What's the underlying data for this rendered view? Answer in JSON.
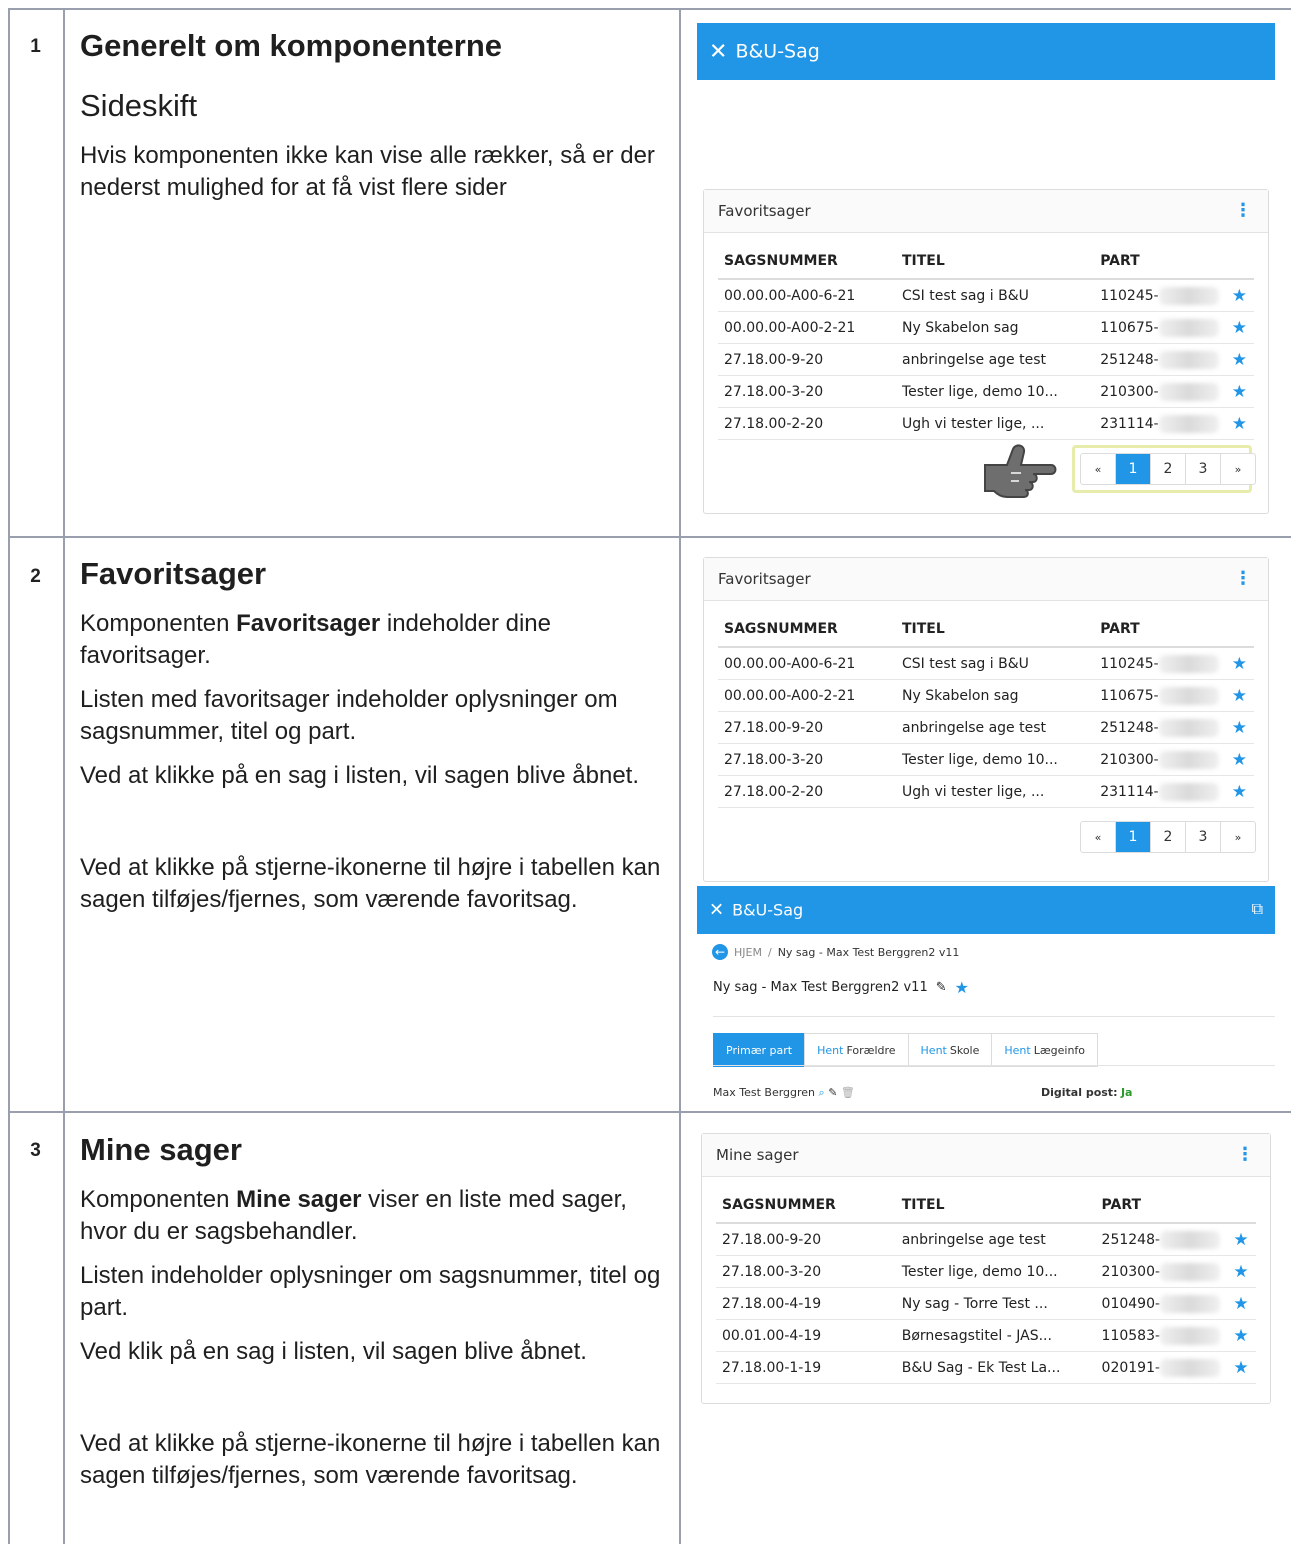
{
  "rows": [
    {
      "number": "1",
      "heading": "Generelt om komponenterne",
      "subheading": "Sideskift",
      "text": "Hvis komponenten ikke kan vise alle rækker, så er der nederst mulighed for at få vist flere sider"
    },
    {
      "number": "2",
      "heading": "Favoritsager",
      "p1_prefix": "Komponenten ",
      "p1_bold": "Favoritsager",
      "p1_suffix": " indeholder dine favoritsager.",
      "p2": "Listen med favoritsager indeholder oplysninger om sagsnummer, titel og part.",
      "p3": "Ved at klikke på en sag i listen, vil sagen blive åbnet.",
      "p4": "Ved at klikke på stjerne-ikonerne til højre i tabellen kan sagen tilføjes/fjernes, som værende favoritsag."
    },
    {
      "number": "3",
      "heading": "Mine sager",
      "p1_prefix": "Komponenten ",
      "p1_bold": "Mine sager",
      "p1_suffix": " viser en liste med sager, hvor du er sagsbehandler.",
      "p2": "Listen indeholder oplysninger om sagsnummer, titel og part.",
      "p3": "Ved klik på en sag i listen, vil sagen blive åbnet.",
      "p4": "Ved at klikke på stjerne-ikonerne til højre i tabellen kan sagen tilføjes/fjernes, som værende favoritsag."
    }
  ],
  "app": {
    "brand": "B&U-Sag",
    "brand_color": "#2196e6"
  },
  "favorites": {
    "title": "Favoritsager",
    "columns": [
      "SAGSNUMMER",
      "TITEL",
      "PART"
    ],
    "rows": [
      {
        "nr": "00.00.00-A00-6-21",
        "title": "CSI test sag i B&U",
        "part": "110245-"
      },
      {
        "nr": "00.00.00-A00-2-21",
        "title": "Ny Skabelon sag",
        "part": "110675-"
      },
      {
        "nr": "27.18.00-9-20",
        "title": "anbringelse age test",
        "part": "251248-"
      },
      {
        "nr": "27.18.00-3-20",
        "title": "Tester lige, demo 10...",
        "part": "210300-"
      },
      {
        "nr": "27.18.00-2-20",
        "title": "Ugh vi tester lige, ...",
        "part": "231114-"
      }
    ],
    "pager": [
      "«",
      "1",
      "2",
      "3",
      "»"
    ]
  },
  "mine": {
    "title": "Mine sager",
    "columns": [
      "SAGSNUMMER",
      "TITEL",
      "PART"
    ],
    "rows": [
      {
        "nr": "27.18.00-9-20",
        "title": "anbringelse age test",
        "part": "251248-"
      },
      {
        "nr": "27.18.00-3-20",
        "title": "Tester lige, demo 10...",
        "part": "210300-"
      },
      {
        "nr": "27.18.00-4-19",
        "title": "Ny sag - Torre Test ...",
        "part": "010490-"
      },
      {
        "nr": "00.01.00-4-19",
        "title": "Børnesagstitel - JAS...",
        "part": "110583-"
      },
      {
        "nr": "27.18.00-1-19",
        "title": "B&U Sag - Ek Test La...",
        "part": "020191-"
      }
    ]
  },
  "case": {
    "crumb_home": "HJEM",
    "crumb_sep": "/",
    "crumb_current": "Ny sag - Max Test Berggren2 v11",
    "title": "Ny sag - Max Test Berggren2 v11",
    "tabs": [
      {
        "label": "Primær part",
        "prefix": ""
      },
      {
        "label": "Forældre",
        "prefix": "Hent"
      },
      {
        "label": "Skole",
        "prefix": "Hent"
      },
      {
        "label": "Lægeinfo",
        "prefix": "Hent"
      }
    ],
    "part_name": "Max Test Berggren",
    "digital_label": "Digital post:",
    "digital_value": "Ja"
  }
}
